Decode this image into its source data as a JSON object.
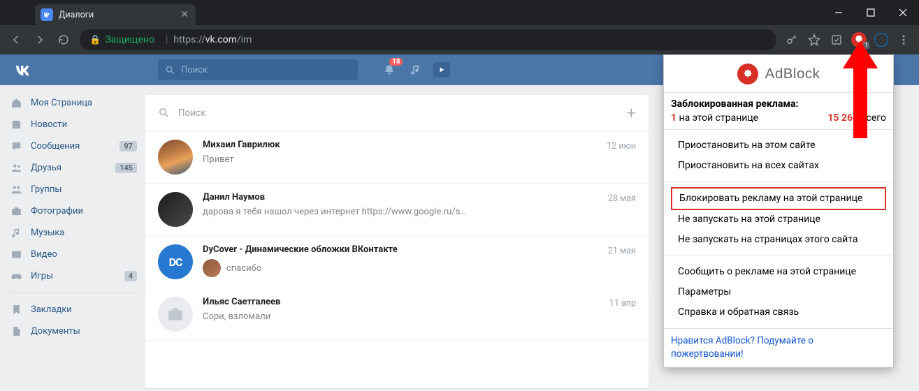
{
  "browser": {
    "tab_title": "Диалоги",
    "secure_label": "Защищено",
    "url_prefix": "https://",
    "url_host": "vk.com",
    "url_path": "/im",
    "adblock_badge": "1"
  },
  "vk": {
    "search_placeholder": "Поиск",
    "notif_count": "18"
  },
  "sidebar": [
    {
      "icon": "home",
      "label": "Моя Страница",
      "badge": null
    },
    {
      "icon": "newspaper",
      "label": "Новости",
      "badge": null
    },
    {
      "icon": "chat",
      "label": "Сообщения",
      "badge": "97"
    },
    {
      "icon": "friends",
      "label": "Друзья",
      "badge": "145"
    },
    {
      "icon": "group",
      "label": "Группы",
      "badge": null
    },
    {
      "icon": "camera",
      "label": "Фотографии",
      "badge": null
    },
    {
      "icon": "music",
      "label": "Музыка",
      "badge": null
    },
    {
      "icon": "video",
      "label": "Видео",
      "badge": null
    },
    {
      "icon": "game",
      "label": "Игры",
      "badge": "4"
    },
    {
      "sep": true
    },
    {
      "icon": "bookmark",
      "label": "Закладки",
      "badge": null
    },
    {
      "icon": "doc",
      "label": "Документы",
      "badge": null
    }
  ],
  "dialogs_search_placeholder": "Поиск",
  "dialogs": [
    {
      "name": "Михаил Гаврилюк",
      "snippet": "Привет",
      "date": "12 июн",
      "avatar": "av1",
      "reply": false
    },
    {
      "name": "Данил Наумов",
      "snippet": "дарова я тебя нашол через интернет https://www.google.ru/s…",
      "date": "28 мая",
      "avatar": "av2",
      "reply": false
    },
    {
      "name": "DyCover - Динамические обложки ВКонтакте",
      "snippet": "спасибо",
      "date": "21 мая",
      "avatar": "av3",
      "avatar_text": "DC",
      "reply": true
    },
    {
      "name": "Ильяс Саетгалеев",
      "snippet": "Сори, взломали",
      "date": "11 апр",
      "avatar": "av4",
      "reply": false
    }
  ],
  "adblock": {
    "logo_text": "AdBlock",
    "blocked_title": "Заблокированная реклама:",
    "page_count": "1",
    "page_suffix": " на этой странице",
    "total_count": "15 266",
    "total_suffix": " всего",
    "items": [
      "Приостановить на этом сайте",
      "Приостановить на всех сайтах",
      "Блокировать рекламу на этой странице",
      "Не запускать на этой странице",
      "Не запускать на страницах этого сайта",
      "Сообщить о рекламе на этой странице",
      "Параметры",
      "Справка и обратная связь"
    ],
    "highlighted_index": 2,
    "section_breaks": [
      2,
      5
    ],
    "donate_line1": "Нравится AdBlock? Подумайте о",
    "donate_line2": "пожертвовании!"
  }
}
